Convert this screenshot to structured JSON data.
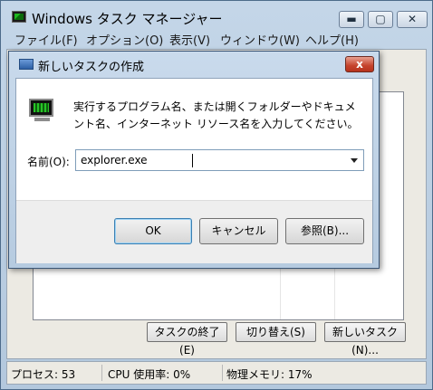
{
  "taskmgr": {
    "title": "Windows タスク マネージャー",
    "caption_buttons": {
      "minimize": "▬",
      "maximize": "▢",
      "close": "✕"
    },
    "menu": [
      "ファイル(F)",
      "オプション(O)",
      "表示(V)",
      "ウィンドウ(W)",
      "ヘルプ(H)"
    ],
    "buttons": {
      "end_task": "タスクの終了(E)",
      "switch_to": "切り替え(S)",
      "new_task": "新しいタスク(N)..."
    },
    "status": {
      "processes": "プロセス: 53",
      "cpu": "CPU 使用率: 0%",
      "memory": "物理メモリ: 17%"
    }
  },
  "run_dialog": {
    "title": "新しいタスクの作成",
    "close_glyph": "x",
    "description": "実行するプログラム名、または開くフォルダーやドキュメント名、インターネット リソース名を入力してください。",
    "name_label": "名前(O):",
    "name_value": "explorer.exe",
    "buttons": {
      "ok": "OK",
      "cancel": "キャンセル",
      "browse": "参照(B)..."
    }
  }
}
